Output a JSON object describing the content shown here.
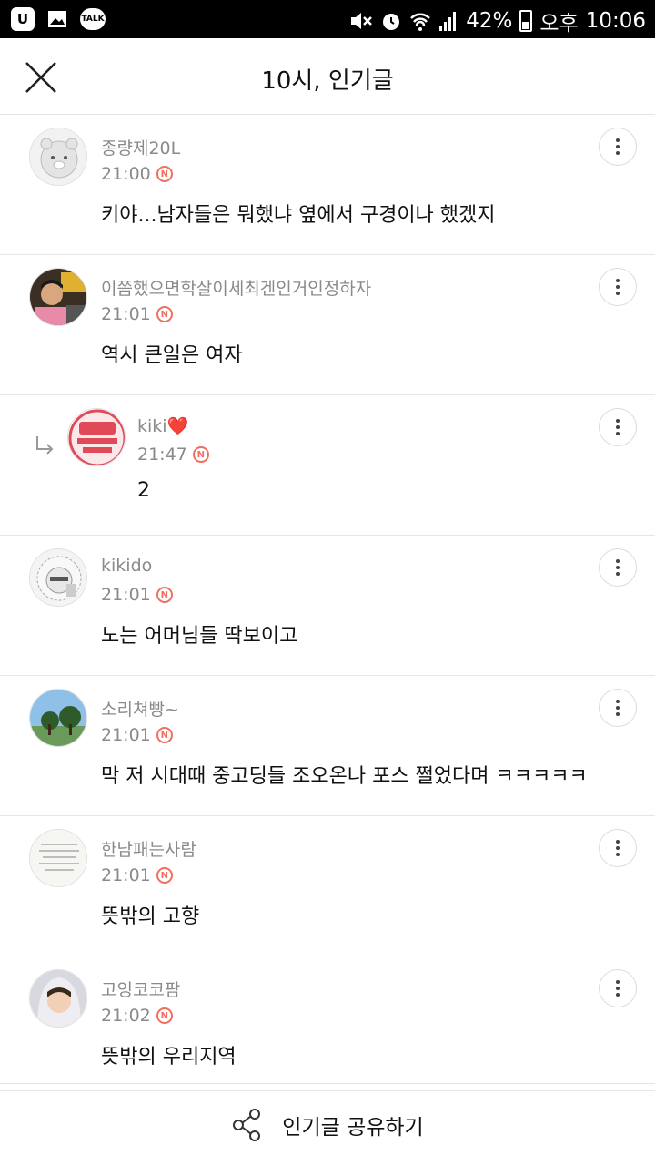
{
  "status_bar": {
    "left_icons": [
      "u-plus-icon",
      "gallery-icon",
      "kakaotalk-icon"
    ],
    "talk_label": "TALK",
    "u_label": "U",
    "battery": "42%",
    "ampm": "오후",
    "time": "10:06"
  },
  "header": {
    "title": "10시, 인기글",
    "close_icon": "close-icon"
  },
  "comments": [
    {
      "nick": "종량제20L",
      "time": "21:00",
      "text": "키야...남자들은 뭐했냐 옆에서 구경이나 했겠지",
      "reply": false
    },
    {
      "nick": "이쯤했으면학살이세최겐인거인정하자",
      "time": "21:01",
      "text": "역시 큰일은 여자",
      "reply": false
    },
    {
      "nick": "kiki❤️",
      "time": "21:47",
      "text": "2",
      "reply": true
    },
    {
      "nick": "kikido",
      "time": "21:01",
      "text": "노는 어머님들 딱보이고",
      "reply": false
    },
    {
      "nick": "소리쳐빵~",
      "time": "21:01",
      "text": "막 저 시대때 중고딩들 조오온나 포스 쩔었다며 ㅋㅋㅋㅋㅋ",
      "reply": false
    },
    {
      "nick": "한남패는사람",
      "time": "21:01",
      "text": "뜻밖의 고향",
      "reply": false
    },
    {
      "nick": "고잉코코팜",
      "time": "21:02",
      "text": "뜻밖의 우리지역",
      "reply": false
    }
  ],
  "badge_letter": "N",
  "footer": {
    "label": "인기글 공유하기",
    "icon": "share-icon"
  },
  "colors": {
    "badge": "#f07060",
    "meta_text": "#8a8a8a",
    "divider": "#e6e6e6"
  }
}
